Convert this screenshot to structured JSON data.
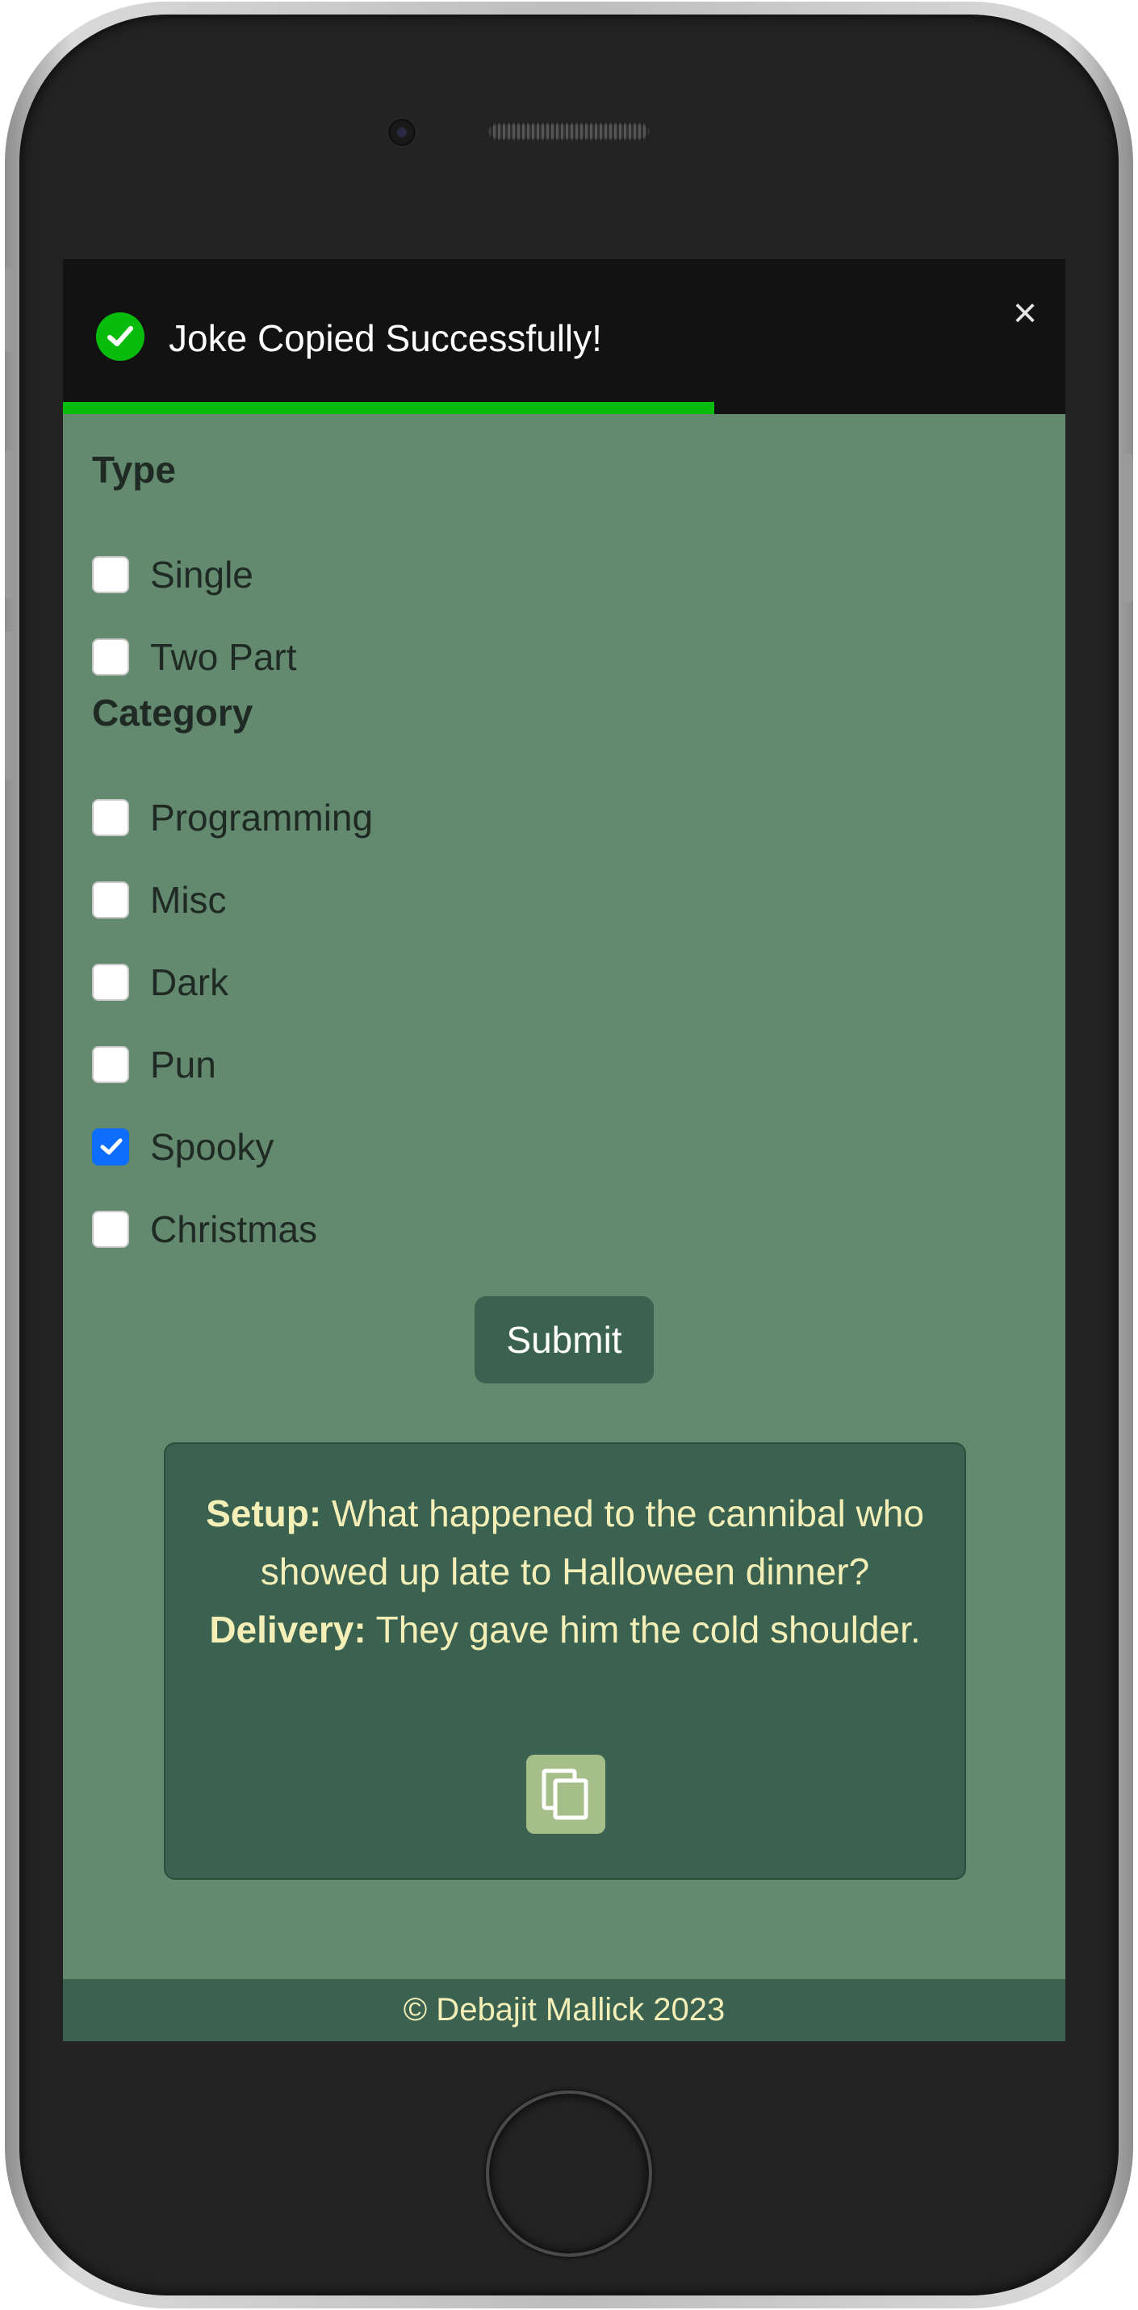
{
  "toast": {
    "message": "Joke Copied Successfully!",
    "close_symbol": "×",
    "icon": "check-circle-icon",
    "progress": 0.65,
    "accent_color": "#07bc0c"
  },
  "form": {
    "type_title": "Type",
    "type_options": [
      {
        "label": "Single",
        "checked": false
      },
      {
        "label": "Two Part",
        "checked": false
      }
    ],
    "category_title": "Category",
    "category_options": [
      {
        "label": "Programming",
        "checked": false
      },
      {
        "label": "Misc",
        "checked": false
      },
      {
        "label": "Dark",
        "checked": false
      },
      {
        "label": "Pun",
        "checked": false
      },
      {
        "label": "Spooky",
        "checked": true
      },
      {
        "label": "Christmas",
        "checked": false
      }
    ],
    "submit_label": "Submit"
  },
  "joke": {
    "setup_label": "Setup:",
    "setup": "What happened to the cannibal who showed up late to Halloween dinner?",
    "delivery_label": "Delivery:",
    "delivery": "They gave him the cold shoulder.",
    "copy_icon": "copy-icon"
  },
  "footer": {
    "text": "© Debajit Mallick 2023"
  },
  "colors": {
    "page_background": "#63896e",
    "card_background": "#3b6150",
    "joke_text": "#f3efb7",
    "checkbox_checked": "#0d6efd"
  }
}
